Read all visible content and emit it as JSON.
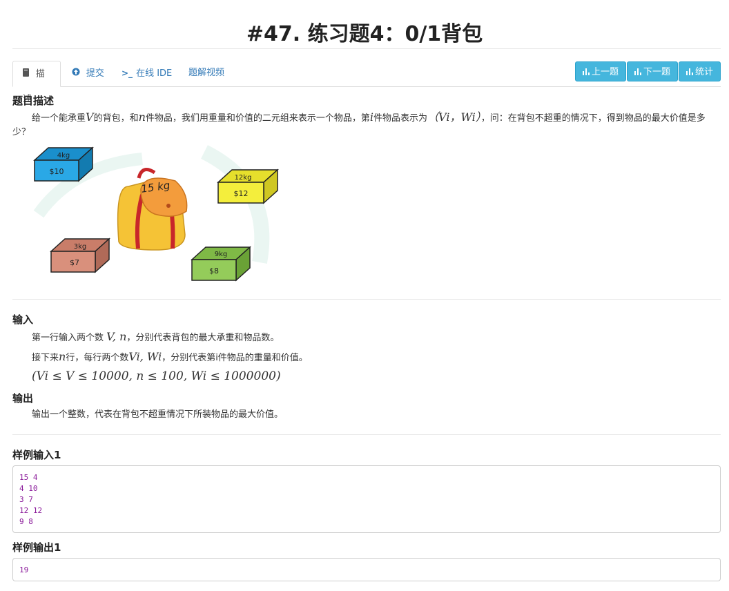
{
  "title": "#47. 练习题4：0/1背包",
  "tabs": [
    {
      "label": "描述",
      "icon": "book-icon"
    },
    {
      "label": "提交",
      "icon": "upload-icon"
    },
    {
      "label": "在线 IDE",
      "icon": "terminal-icon"
    },
    {
      "label": "题解视频",
      "icon": ""
    }
  ],
  "nav_buttons": [
    {
      "label": "上一题",
      "icon": "bar-chart-icon"
    },
    {
      "label": "下一题",
      "icon": "bar-chart-icon"
    },
    {
      "label": "统计",
      "icon": "bar-chart-icon"
    }
  ],
  "description": {
    "heading": "题目描述",
    "text_a": "给一个能承重",
    "var_v": "V",
    "text_b": "的背包，和",
    "var_n": "n",
    "text_c": "件物品，我们用重量和价值的二元组来表示一个物品，第",
    "var_i": "i",
    "text_d": "件物品表示为",
    "tuple": "（Vi，Wi）",
    "text_e": "，问：在背包不超重的情况下，得到物品的最大价值是多少？",
    "figure": {
      "bag": "15 kg",
      "items": [
        {
          "weight": "4kg",
          "value": "$10",
          "color": "#2aa8e6"
        },
        {
          "weight": "12kg",
          "value": "$12",
          "color": "#f4ee3c"
        },
        {
          "weight": "3kg",
          "value": "$7",
          "color": "#d9907c"
        },
        {
          "weight": "9kg",
          "value": "$8",
          "color": "#94cc5a"
        }
      ]
    }
  },
  "input": {
    "heading": "输入",
    "line1_a": "第一行输入两个数",
    "line1_math": "V, n",
    "line1_b": "，分别代表背包的最大承重和物品数。",
    "line2_a": "接下来",
    "line2_var": "n",
    "line2_b": "行，每行两个数",
    "line2_math": "Vi, Wi",
    "line2_c": "，分别代表第i件物品的重量和价值。",
    "constraint": "(Vi ≤ V ≤ 10000, n ≤ 100, Wi ≤ 1000000)"
  },
  "output": {
    "heading": "输出",
    "text": "输出一个整数，代表在背包不超重情况下所装物品的最大价值。"
  },
  "sample_input": {
    "heading": "样例输入1",
    "content": "15 4\n4 10\n3 7\n12 12\n9 8"
  },
  "sample_output": {
    "heading": "样例输出1",
    "content": "19"
  }
}
